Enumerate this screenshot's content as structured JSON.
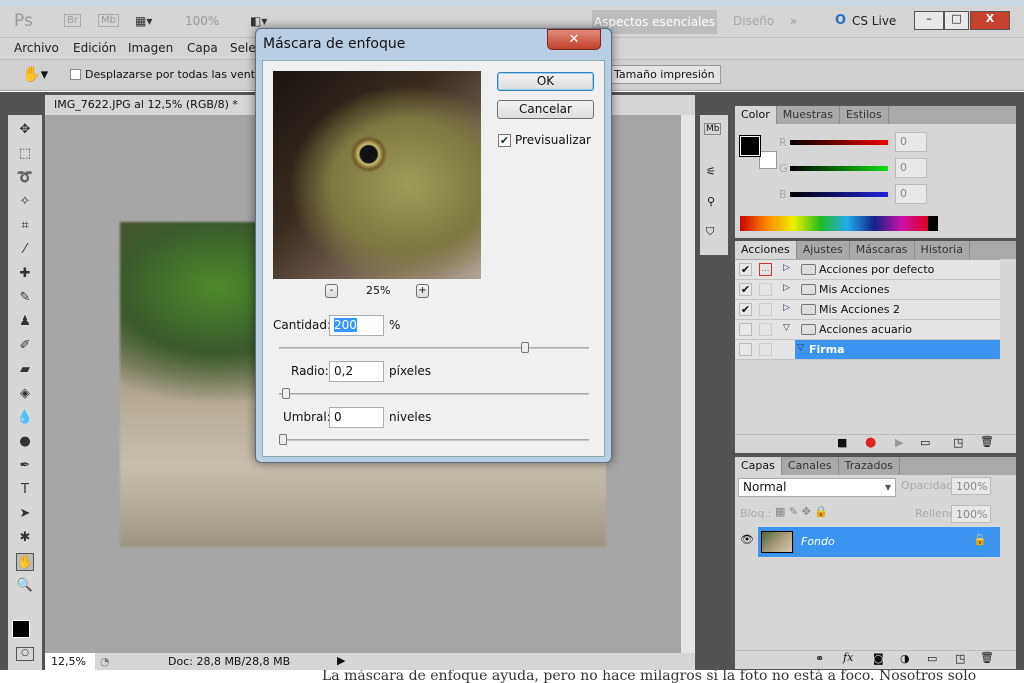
{
  "appbar": {
    "logo": "Ps",
    "br": "Br",
    "mb": "Mb",
    "zoom": "100%",
    "workspace_active": "Aspectos esenciales",
    "workspace_other": "Diseño",
    "more": "»",
    "cslive": "CS Live",
    "minimize": "–",
    "maximize": "□",
    "close": "X"
  },
  "menu": [
    "Archivo",
    "Edición",
    "Imagen",
    "Capa",
    "Sele"
  ],
  "options": {
    "scroll_all": "Desplazarse por todas las ventanas",
    "print_size": "Tamaño impresión"
  },
  "document": {
    "tab": "IMG_7622.JPG al 12,5% (RGB/8) *",
    "zoom": "12,5%",
    "doc_info": "Doc: 28,8 MB/28,8 MB"
  },
  "dialog": {
    "title": "Máscara de enfoque",
    "ok": "OK",
    "cancel": "Cancelar",
    "preview_label": "Previsualizar",
    "preview_checked": true,
    "preview_zoom": "25%",
    "minus": "-",
    "plus": "+",
    "amount_label": "Cantidad:",
    "amount": "200",
    "amount_unit": "%",
    "amount_slider_pct": 80,
    "radius_label": "Radio:",
    "radius": "0,2",
    "radius_unit": "píxeles",
    "radius_slider_pct": 1,
    "threshold_label": "Umbral:",
    "threshold": "0",
    "threshold_unit": "niveles",
    "threshold_slider_pct": 0
  },
  "color_panel": {
    "tabs": [
      "Color",
      "Muestras",
      "Estilos"
    ],
    "r_label": "R",
    "g_label": "G",
    "b_label": "B",
    "r": "0",
    "g": "0",
    "b": "0",
    "foreground": "#000000",
    "background": "#ffffff"
  },
  "actions_panel": {
    "tabs": [
      "Acciones",
      "Ajustes",
      "Máscaras",
      "Historia"
    ],
    "items": [
      {
        "label": "Acciones por defecto",
        "checked": true
      },
      {
        "label": "Mis Acciones",
        "checked": true
      },
      {
        "label": "Mis Acciones 2",
        "checked": true
      },
      {
        "label": "Acciones acuario",
        "checked": false
      },
      {
        "label": "Firma",
        "checked": false,
        "selected": true
      }
    ]
  },
  "layers_panel": {
    "tabs": [
      "Capas",
      "Canales",
      "Trazados"
    ],
    "blend_mode": "Normal",
    "opacity_label": "Opacidad:",
    "opacity": "100%",
    "lock_label": "Bloq.:",
    "fill_label": "Relleno:",
    "fill": "100%",
    "layer": "Fondo"
  },
  "page_text": "La máscara de enfoque ayuda, pero no hace milagros si la foto no está a foco. Nosotros solo"
}
